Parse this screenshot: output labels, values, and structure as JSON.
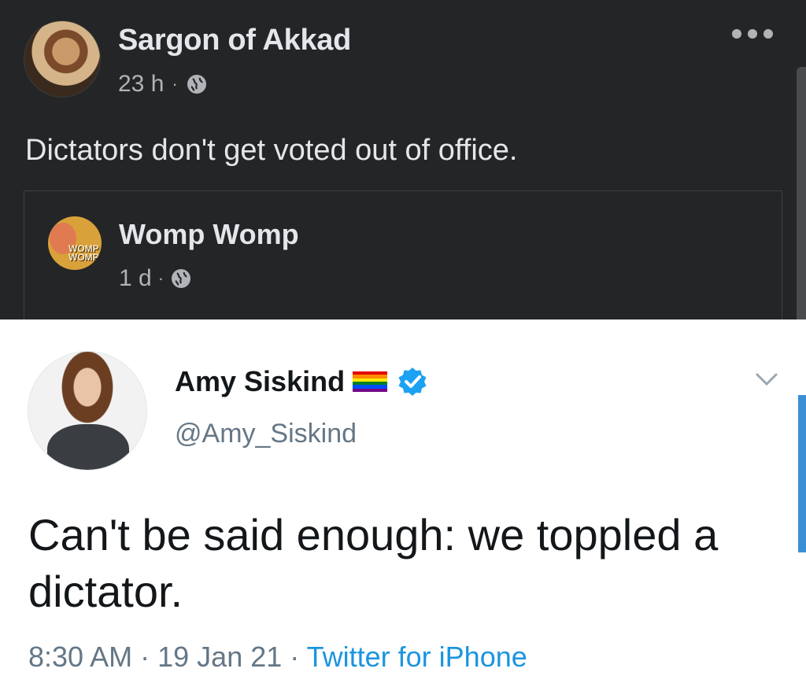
{
  "facebook_post": {
    "author": "Sargon of Akkad",
    "time": "23 h",
    "separator": "·",
    "text": "Dictators don't get voted out of office.",
    "shared": {
      "author": "Womp Womp",
      "avatar_text": "WOMP WOMP",
      "time": "1 d",
      "separator": "·"
    }
  },
  "tweet": {
    "name": "Amy Siskind",
    "handle": "@Amy_Siskind",
    "text": "Can't be said enough:  we toppled a dictator.",
    "time": "8:30 AM",
    "date": "19 Jan 21",
    "separator": "·",
    "source": "Twitter for iPhone"
  },
  "colors": {
    "fb_background": "#242526",
    "fb_text": "#e4e6eb",
    "fb_secondary": "#b0b3b8",
    "twitter_blue": "#1b95e0",
    "twitter_secondary": "#657786"
  },
  "icons": [
    "globe-icon",
    "more-options-icon",
    "rainbow-flag-icon",
    "verified-badge-icon",
    "chevron-down-icon"
  ]
}
